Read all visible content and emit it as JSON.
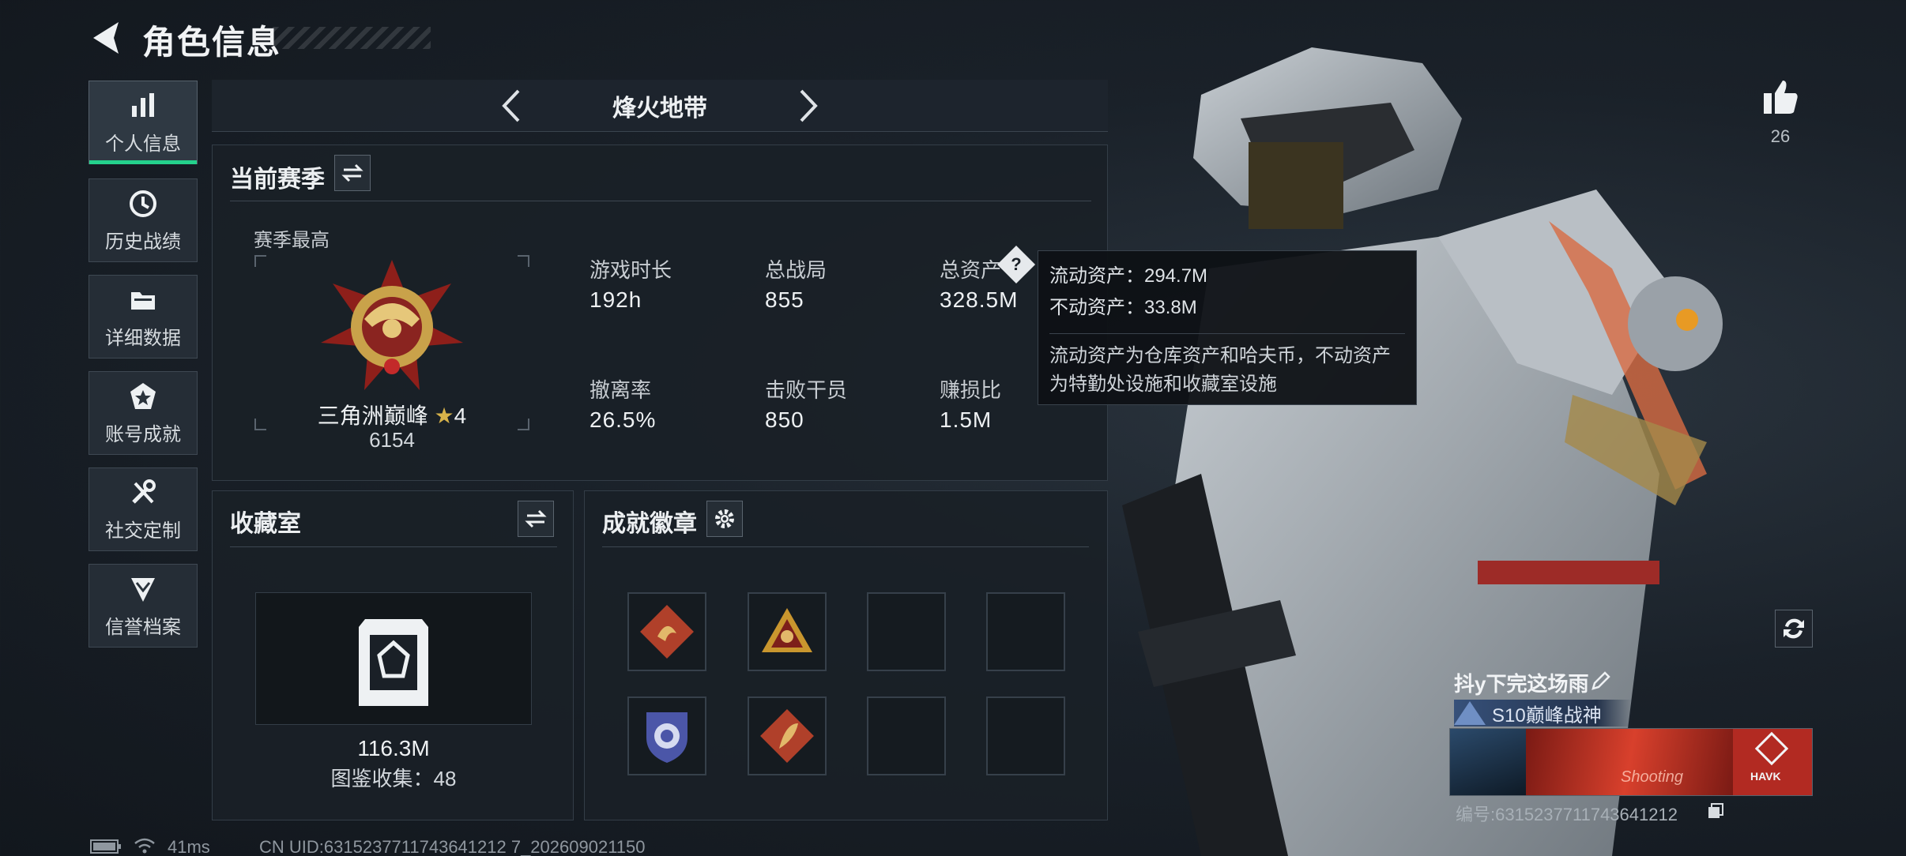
{
  "header": {
    "title": "角色信息"
  },
  "sidebar": {
    "items": [
      {
        "label": "个人信息",
        "icon": "bar-chart-icon",
        "active": true
      },
      {
        "label": "历史战绩",
        "icon": "history-clock-icon",
        "active": false
      },
      {
        "label": "详细数据",
        "icon": "folder-icon",
        "active": false
      },
      {
        "label": "账号成就",
        "icon": "achievement-star-icon",
        "active": false
      },
      {
        "label": "社交定制",
        "icon": "tools-icon",
        "active": false
      },
      {
        "label": "信誉档案",
        "icon": "shield-chevron-icon",
        "active": false
      }
    ]
  },
  "mode": {
    "title": "烽火地带"
  },
  "season": {
    "title": "当前赛季",
    "highest_label": "赛季最高",
    "rank_name": "三角洲巅峰",
    "rank_stars": "4",
    "rank_points": "6154",
    "stats": [
      {
        "label": "游戏时长",
        "value": "192h"
      },
      {
        "label": "总战局",
        "value": "855"
      },
      {
        "label": "总资产",
        "value": "328.5M"
      },
      {
        "label": "撤离率",
        "value": "26.5%"
      },
      {
        "label": "击败干员",
        "value": "850"
      },
      {
        "label": "赚损比",
        "value": "1.5M"
      }
    ]
  },
  "tooltip": {
    "liquid": "流动资产：294.7M",
    "fixed": "不动资产：33.8M",
    "desc_line1": "流动资产为仓库资产和哈夫币，不动资产",
    "desc_line2": "为特勤处设施和收藏室设施"
  },
  "collection": {
    "title": "收藏室",
    "value": "116.3M",
    "catalog": "图鉴收集：48"
  },
  "badges": {
    "title": "成就徽章"
  },
  "profile": {
    "likes": "26",
    "player_name": "抖y下完这场雨",
    "title_badge": "S10巅峰战神",
    "card_logo": "HAVK",
    "card_script": "Shooting",
    "id_line": "编号:6315237711743641212"
  },
  "status": {
    "ping": "41ms",
    "uid": "CN UID:6315237711743641212 7_202609021150"
  },
  "colors": {
    "accent": "#24d18c",
    "panel": "#1a2027",
    "gold": "#c9a24a",
    "red": "#b6302a"
  }
}
